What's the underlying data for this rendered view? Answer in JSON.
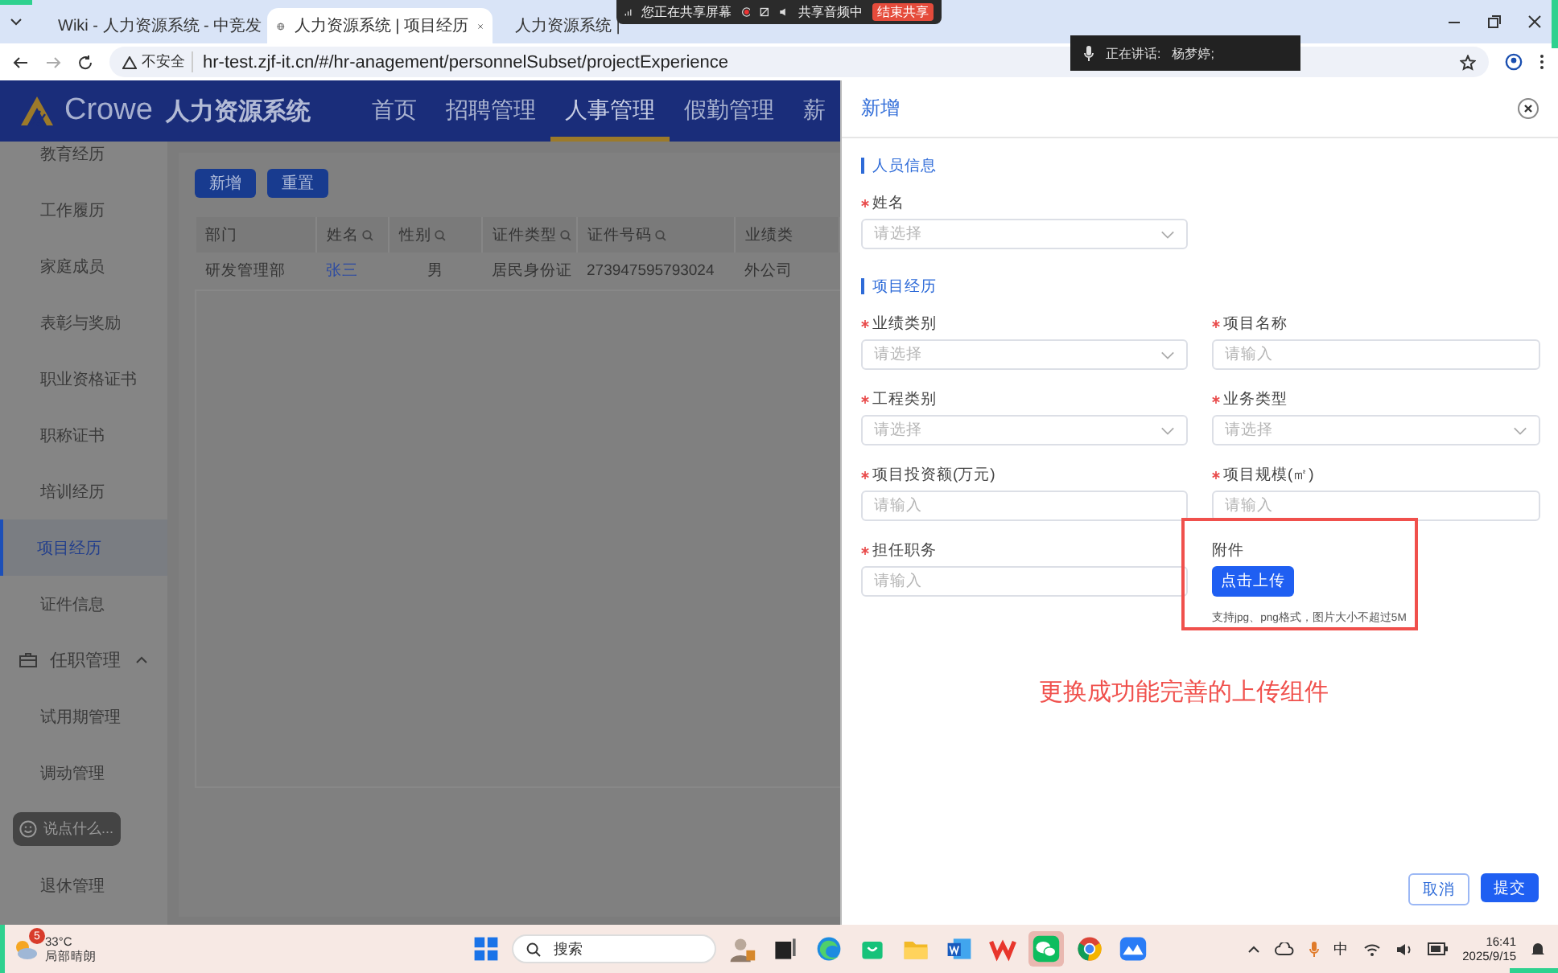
{
  "browser": {
    "tabs": [
      {
        "title": "Wiki - 人力资源系统 - 中竞发",
        "selected": false
      },
      {
        "title": "人力资源系统 | 项目经历",
        "selected": true
      },
      {
        "title": "人力资源系统 |",
        "selected": false
      }
    ],
    "security": "不安全",
    "url": "hr-test.zjf-it.cn/#/hr-anagement/personnelSubset/projectExperience"
  },
  "share_bar": {
    "status": "您正在共享屏幕",
    "audio": "共享音频中",
    "stop": "结束共享"
  },
  "speaking": {
    "label": "正在讲话:",
    "name": "杨梦婷;"
  },
  "app": {
    "brand": "Crowe",
    "system": "人力资源系统",
    "nav": [
      {
        "label": "首页",
        "selected": false
      },
      {
        "label": "招聘管理",
        "selected": false
      },
      {
        "label": "人事管理",
        "selected": true
      },
      {
        "label": "假勤管理",
        "selected": false
      },
      {
        "label": "薪",
        "selected": false
      }
    ]
  },
  "sidebar": {
    "items": [
      {
        "label": "教育经历",
        "selected": false
      },
      {
        "label": "工作履历",
        "selected": false
      },
      {
        "label": "家庭成员",
        "selected": false
      },
      {
        "label": "表彰与奖励",
        "selected": false
      },
      {
        "label": "职业资格证书",
        "selected": false
      },
      {
        "label": "职称证书",
        "selected": false
      },
      {
        "label": "培训经历",
        "selected": false
      },
      {
        "label": "项目经历",
        "selected": true
      },
      {
        "label": "证件信息",
        "selected": false
      }
    ],
    "group": {
      "label": "任职管理",
      "expanded": true,
      "children": [
        {
          "label": "试用期管理",
          "selected": false
        },
        {
          "label": "调动管理",
          "selected": false
        },
        {
          "label": "退休管理",
          "selected": false
        }
      ]
    }
  },
  "comment": {
    "placeholder": "说点什么..."
  },
  "toolbar": {
    "buttons": [
      "新增",
      "重置"
    ]
  },
  "table": {
    "columns": [
      {
        "label": "部门",
        "filterable": false,
        "link": false
      },
      {
        "label": "姓名",
        "filterable": true,
        "link": true
      },
      {
        "label": "性别",
        "filterable": true,
        "link": false
      },
      {
        "label": "证件类型",
        "filterable": true,
        "link": false
      },
      {
        "label": "证件号码",
        "filterable": true,
        "link": false
      },
      {
        "label": "业绩类",
        "filterable": false,
        "link": false
      }
    ],
    "rows": [
      [
        "研发管理部",
        "张三",
        "男",
        "居民身份证",
        "273947595793024",
        "外公司"
      ]
    ]
  },
  "drawer": {
    "title": "新增",
    "sections": [
      {
        "title": "人员信息",
        "fields": [
          {
            "label": "姓名",
            "required": true,
            "kind": "select",
            "placeholder": "请选择"
          }
        ]
      },
      {
        "title": "项目经历",
        "fields": [
          {
            "label": "业绩类别",
            "required": true,
            "kind": "select",
            "placeholder": "请选择"
          },
          {
            "label": "项目名称",
            "required": true,
            "kind": "input",
            "placeholder": "请输入"
          },
          {
            "label": "工程类别",
            "required": true,
            "kind": "select",
            "placeholder": "请选择"
          },
          {
            "label": "业务类型",
            "required": true,
            "kind": "select",
            "placeholder": "请选择"
          },
          {
            "label": "项目投资额(万元)",
            "required": true,
            "kind": "input",
            "placeholder": "请输入"
          },
          {
            "label": "项目规模(㎡)",
            "required": true,
            "kind": "input",
            "placeholder": "请输入"
          },
          {
            "label": "担任职务",
            "required": true,
            "kind": "input",
            "placeholder": "请输入"
          },
          {
            "label": "附件",
            "required": false,
            "kind": "upload",
            "button": "点击上传",
            "hint": "支持jpg、png格式，图片大小不超过5M",
            "annotated": true
          }
        ]
      }
    ],
    "annotation": "更换成功能完善的上传组件",
    "actions": [
      {
        "label": "取消",
        "kind": "secondary"
      },
      {
        "label": "提交",
        "kind": "primary"
      }
    ]
  },
  "taskbar": {
    "weather": {
      "badge": "5",
      "temp": "33°C",
      "text": "局部晴朗"
    },
    "search": {
      "placeholder": "搜索"
    },
    "apps": [
      {
        "kind": "start",
        "active": false
      },
      {
        "kind": "figure",
        "active": false
      },
      {
        "kind": "taskview",
        "active": false
      },
      {
        "kind": "browser",
        "active": false
      },
      {
        "kind": "bag",
        "active": false
      },
      {
        "kind": "folder",
        "active": false
      },
      {
        "kind": "doc",
        "active": false
      },
      {
        "kind": "wps",
        "active": false
      },
      {
        "kind": "chat",
        "active": true
      },
      {
        "kind": "chrome",
        "active": false
      },
      {
        "kind": "cloud",
        "active": false
      }
    ],
    "ime": "中",
    "time": "16:41",
    "date": "2025/9/15"
  }
}
